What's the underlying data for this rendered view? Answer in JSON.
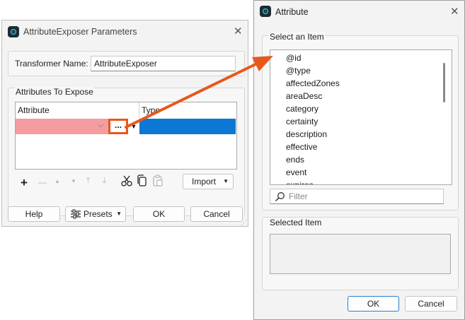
{
  "params_dialog": {
    "title": "AttributeExposer Parameters",
    "transformer_name_label": "Transformer Name:",
    "transformer_name_value": "AttributeExposer",
    "attributes_group_label": "Attributes To Expose",
    "table": {
      "columns": [
        "Attribute",
        "Type"
      ],
      "row_ellipsis": "...",
      "row_attr_value": "",
      "row_type_value": ""
    },
    "toolbar": {
      "add": "+",
      "remove": "—",
      "move_up": "▲",
      "move_down": "▼",
      "move_top": "⤒",
      "move_bottom": "⤓",
      "import_label": "Import"
    },
    "buttons": {
      "help": "Help",
      "presets": "Presets",
      "ok": "OK",
      "cancel": "Cancel"
    }
  },
  "attribute_dialog": {
    "title": "Attribute",
    "select_group_label": "Select an Item",
    "items": [
      "@id",
      "@type",
      "affectedZones",
      "areaDesc",
      "category",
      "certainty",
      "description",
      "effective",
      "ends",
      "event",
      "expires"
    ],
    "filter_placeholder": "Filter",
    "selected_group_label": "Selected Item",
    "selected_value": "",
    "buttons": {
      "ok": "OK",
      "cancel": "Cancel"
    }
  },
  "colors": {
    "annotation_arrow": "#e8581c",
    "invalid_cell": "#f49ca0",
    "selected_cell": "#0a78d4"
  }
}
